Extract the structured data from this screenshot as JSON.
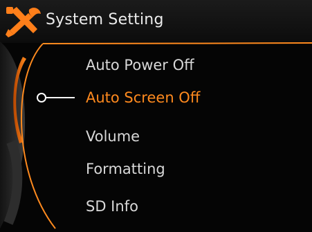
{
  "header": {
    "title": "System Setting",
    "icon": "tools-icon"
  },
  "menu": {
    "items": [
      {
        "label": "Auto Power Off",
        "selected": false
      },
      {
        "label": "Auto Screen Off",
        "selected": true
      },
      {
        "label": "Volume",
        "selected": false
      },
      {
        "label": "Formatting",
        "selected": false
      },
      {
        "label": "SD Info",
        "selected": false
      }
    ]
  },
  "colors": {
    "accent": "#ff8a1e",
    "text": "#d8d8d8",
    "background": "#050505"
  }
}
